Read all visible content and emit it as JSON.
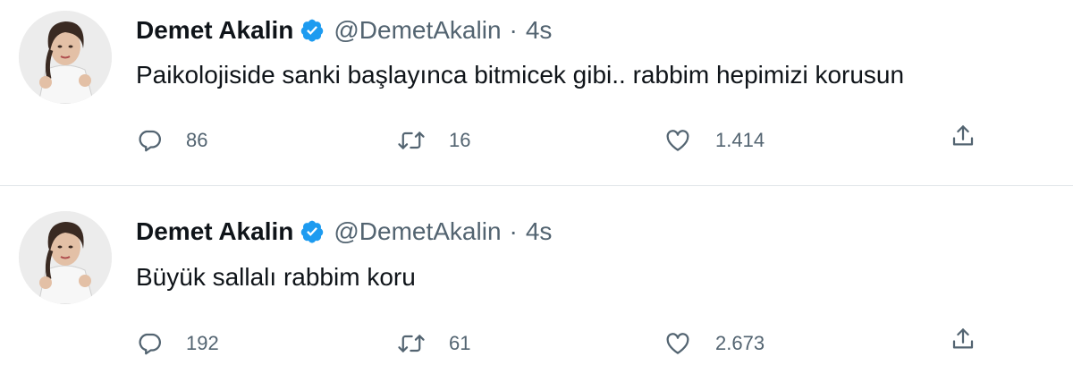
{
  "tweets": [
    {
      "author_name": "Demet Akalin",
      "handle": "@DemetAkalin",
      "separator": "·",
      "time": "4s",
      "text": "Paikolojiside sanki başlayınca bitmicek gibi.. rabbim hepimizi korusun",
      "replies": "86",
      "retweets": "16",
      "likes": "1.414"
    },
    {
      "author_name": "Demet Akalin",
      "handle": "@DemetAkalin",
      "separator": "·",
      "time": "4s",
      "text": "Büyük sallalı rabbim koru",
      "replies": "192",
      "retweets": "61",
      "likes": "2.673"
    }
  ],
  "icons": {
    "verified": "verified-badge-icon",
    "reply": "reply-icon",
    "retweet": "retweet-icon",
    "like": "heart-icon",
    "share": "share-icon"
  },
  "colors": {
    "verified_blue": "#1d9bf0",
    "text_primary": "#0f1419",
    "text_secondary": "#536471",
    "divider": "#e1e5e9"
  }
}
